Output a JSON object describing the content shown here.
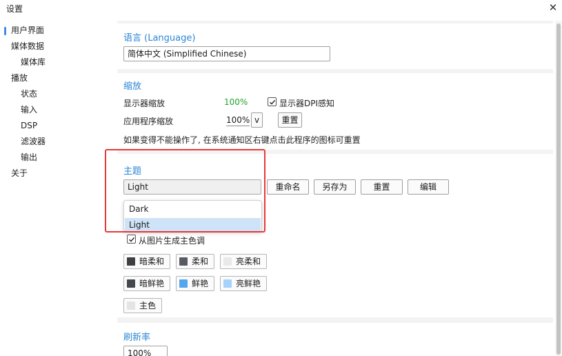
{
  "window": {
    "title": "设置",
    "close_icon": "close-icon"
  },
  "sidebar": {
    "items": [
      {
        "label": "用户界面",
        "level": 1,
        "active": true
      },
      {
        "label": "媒体数据",
        "level": 1
      },
      {
        "label": "媒体库",
        "level": 2
      },
      {
        "label": "播放",
        "level": 1
      },
      {
        "label": "状态",
        "level": 2
      },
      {
        "label": "输入",
        "level": 2
      },
      {
        "label": "DSP",
        "level": 2
      },
      {
        "label": "滤波器",
        "level": 2
      },
      {
        "label": "输出",
        "level": 2
      },
      {
        "label": "关于",
        "level": 1
      }
    ]
  },
  "language": {
    "title": "语言 (Language)",
    "value": "简体中文 (Simplified Chinese)"
  },
  "scaling": {
    "title": "缩放",
    "display_label": "显示器缩放",
    "display_value": "100%",
    "dpi_aware_label": "显示器DPI感知",
    "dpi_aware_checked": true,
    "app_label": "应用程序缩放",
    "app_value": "100%",
    "unit_selector": "v",
    "reset_label": "重置",
    "hint": "如果变得不能操作了, 在系统通知区右键点击此程序的图标可重置"
  },
  "theme": {
    "title": "主题",
    "current": "Light",
    "rename_label": "重命名",
    "save_as_label": "另存为",
    "reset_label": "重置",
    "edit_label": "编辑",
    "options": [
      "Dark",
      "Light"
    ],
    "selected_option": "Light",
    "gen_from_image_label": "从图片生成主色调",
    "gen_from_image_checked": true,
    "palette": {
      "dark_soft": {
        "label": "暗柔和",
        "color": "#3d3f42"
      },
      "soft": {
        "label": "柔和",
        "color": "#585c62"
      },
      "light_soft": {
        "label": "亮柔和",
        "color": "#e9e9e9"
      },
      "dark_vivid": {
        "label": "暗鲜艳",
        "color": "#45484c"
      },
      "vivid": {
        "label": "鲜艳",
        "color": "#52a7ef"
      },
      "light_vivid": {
        "label": "亮鲜艳",
        "color": "#a6d3fb"
      },
      "main": {
        "label": "主色",
        "color": "#e4e4e4"
      }
    }
  },
  "refresh": {
    "title": "刷新率",
    "value": "100%"
  },
  "colors": {
    "accent": "#2b86d6",
    "success": "#1fa32a",
    "highlight_border": "#e53935"
  }
}
